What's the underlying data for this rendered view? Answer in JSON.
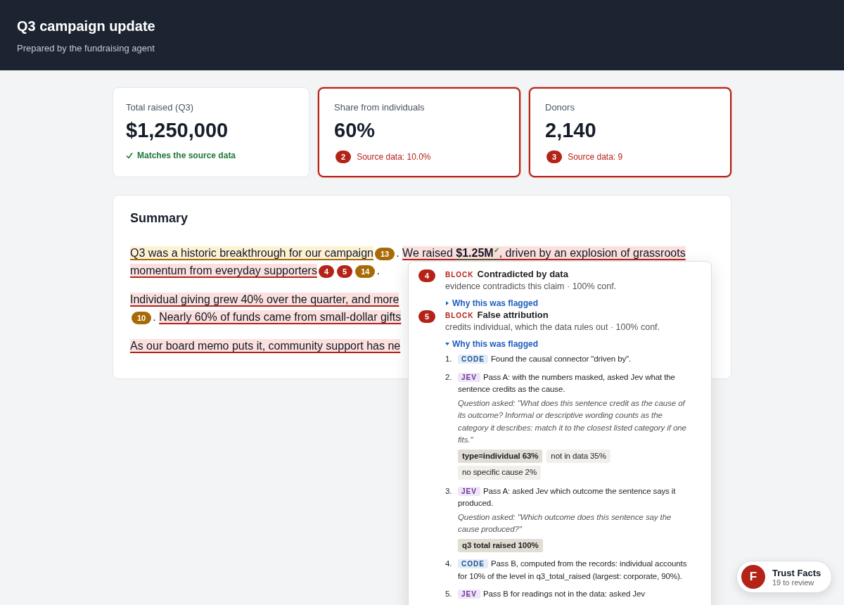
{
  "header": {
    "title": "Q3 campaign update",
    "subtitle": "Prepared by the fundraising agent"
  },
  "metrics": [
    {
      "label": "Total raised (Q3)",
      "value": "$1,250,000",
      "flagged": false,
      "note": "Matches the source data"
    },
    {
      "label": "Share from individuals",
      "value": "60%",
      "flagged": true,
      "badge": "2",
      "note": "Source data: 10.0%"
    },
    {
      "label": "Donors",
      "value": "2,140",
      "flagged": true,
      "badge": "3",
      "note": "Source data: 9"
    }
  ],
  "summary": {
    "title": "Summary",
    "paragraphs": [
      {
        "lines": [
          [
            {
              "kind": "claim",
              "blocking": false,
              "parts": [
                {
                  "text": "Q3 was a historic breakthrough for our campaign"
                }
              ]
            },
            {
              "kind": "badge",
              "color": "#a86a06",
              "label": "13"
            },
            {
              "kind": "plain",
              "text": ". "
            },
            {
              "kind": "claim",
              "blocking": true,
              "parts": [
                {
                  "text": "We raised "
                },
                {
                  "text": "$1.25M",
                  "verified": true,
                  "mark": "✓"
                },
                {
                  "text": ", driven by an explosion of grassroots"
                }
              ]
            }
          ],
          [
            {
              "kind": "claim",
              "blocking": true,
              "parts": [
                {
                  "text": "momentum from everyday supporters"
                }
              ]
            },
            {
              "kind": "badge",
              "color": "#b42318",
              "label": "4"
            },
            {
              "kind": "badge",
              "color": "#b42318",
              "label": "5"
            },
            {
              "kind": "badge",
              "color": "#a86a06",
              "label": "14"
            },
            {
              "kind": "plain",
              "text": "."
            }
          ]
        ]
      },
      {
        "lines": [
          [
            {
              "kind": "claim",
              "blocking": true,
              "parts": [
                {
                  "text": "Individual giving grew 40% over the quarter, and more"
                }
              ]
            }
          ],
          [
            {
              "kind": "badge",
              "color": "#a86a06",
              "label": "10"
            },
            {
              "kind": "plain",
              "text": ". "
            },
            {
              "kind": "claim",
              "blocking": true,
              "parts": [
                {
                  "text": "Nearly 60% of funds came from small-dollar gifts"
                }
              ]
            }
          ]
        ]
      },
      {
        "lines": [
          [
            {
              "kind": "claim",
              "blocking": true,
              "parts": [
                {
                  "text": "As our board memo puts it, community support has ne"
                }
              ]
            }
          ]
        ]
      }
    ]
  },
  "popover": {
    "flags": [
      {
        "badge": "4",
        "level": "BLOCK",
        "title": "Contradicted by data",
        "detail": "evidence contradicts this claim · 100% conf.",
        "why": {
          "label": "Why this was flagged",
          "expanded": false
        }
      },
      {
        "badge": "5",
        "level": "BLOCK",
        "title": "False attribution",
        "detail": "credits individual, which the data rules out · 100% conf.",
        "why": {
          "label": "Why this was flagged",
          "expanded": true
        },
        "steps": [
          {
            "number": "1.",
            "kind": "code",
            "tag": "CODE",
            "text": "Found the causal connector \"driven by\"."
          },
          {
            "number": "2.",
            "kind": "jev",
            "tag": "JEV",
            "text": "Pass A: with the numbers masked, asked Jev what the sentence credits as the cause.",
            "question": "Question asked: \"What does this sentence credit as the cause of its outcome? Informal or descriptive wording counts as the category it describes: match it to the closest listed category if one fits.\"",
            "chips": [
              {
                "label": "type=individual 63%",
                "top": true
              },
              {
                "label": "not in data 35%",
                "top": false
              },
              {
                "label": "no specific cause 2%",
                "top": false
              }
            ]
          },
          {
            "number": "3.",
            "kind": "jev",
            "tag": "JEV",
            "text": "Pass A: asked Jev which outcome the sentence says it produced.",
            "question": "Question asked: \"Which outcome does this sentence say the cause produced?\"",
            "chips": [
              {
                "label": "q3 total raised 100%",
                "top": true
              }
            ]
          },
          {
            "number": "4.",
            "kind": "code",
            "tag": "CODE",
            "text": "Pass B, computed from the records: individual accounts for 10% of the level in q3_total_raised (largest: corporate, 90%)."
          },
          {
            "number": "5.",
            "kind": "jev",
            "tag": "JEV",
            "text": "Pass B for readings not in the data: asked Jev"
          }
        ]
      }
    ]
  },
  "trust": {
    "initial": "F",
    "title": "Trust Facts",
    "subtitle": "19 to review"
  }
}
